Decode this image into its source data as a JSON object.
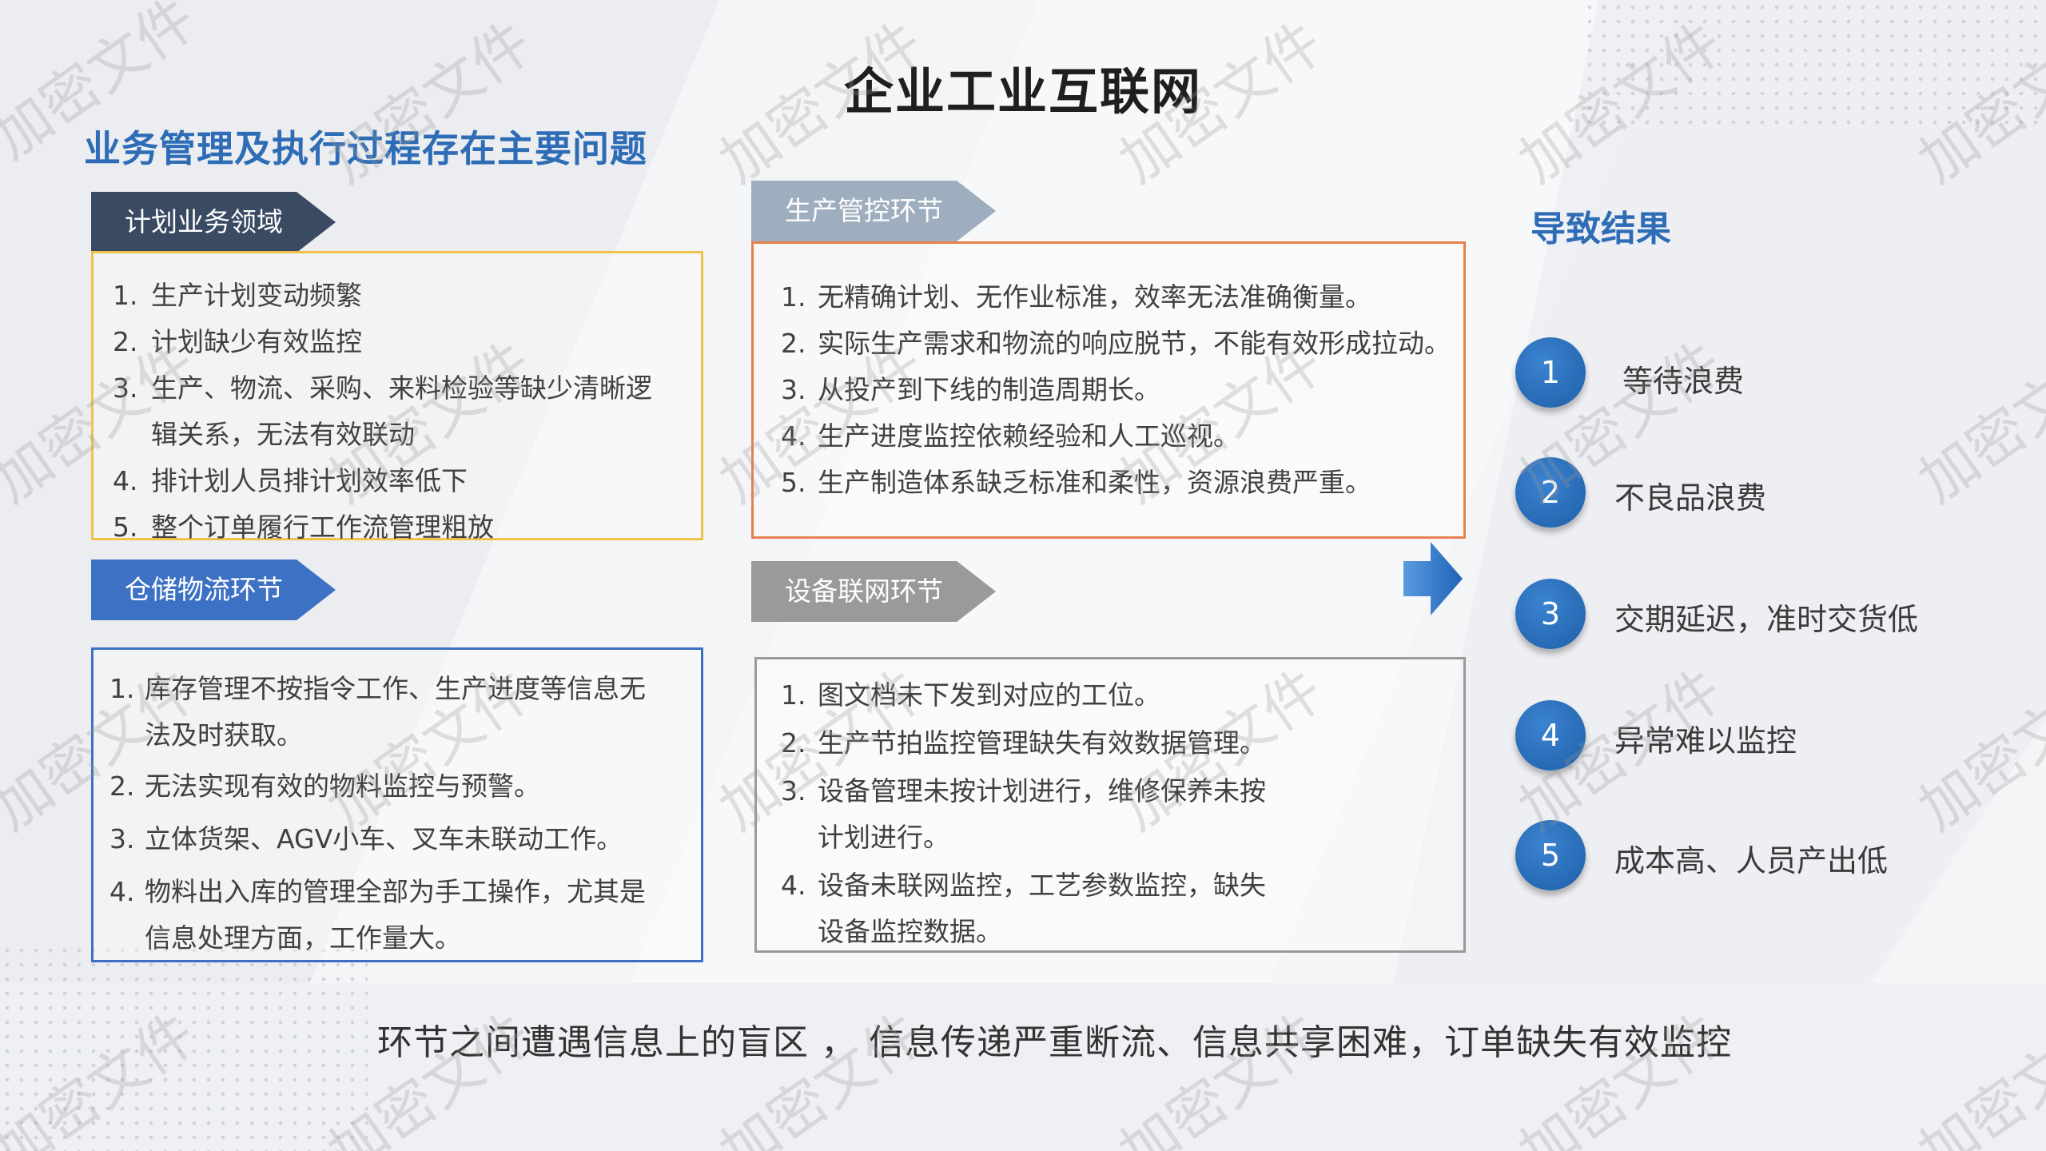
{
  "title": "企业工业互联网",
  "subtitle": "业务管理及执行过程存在主要问题",
  "planning": {
    "tag": "计划业务领域",
    "items": [
      {
        "num": "1.",
        "text": "生产计划变动频繁"
      },
      {
        "num": "2.",
        "text": "计划缺少有效监控"
      },
      {
        "num": "3.",
        "text": "生产、物流、采购、来料检验等缺少清晰逻辑关系，无法有效联动"
      },
      {
        "num": "4.",
        "text": "排计划人员排计划效率低下"
      },
      {
        "num": "5.",
        "text": "整个订单履行工作流管理粗放"
      }
    ]
  },
  "warehouse": {
    "tag": "仓储物流环节",
    "items": [
      {
        "num": "1.",
        "text": "库存管理不按指令工作、生产进度等信息无法及时获取。"
      },
      {
        "num": "2.",
        "text": "无法实现有效的物料监控与预警。"
      },
      {
        "num": "3.",
        "text": "立体货架、AGV小车、叉车未联动工作。"
      },
      {
        "num": "4.",
        "text": "物料出入库的管理全部为手工操作，尤其是信息处理方面，工作量大。"
      }
    ]
  },
  "production": {
    "tag": "生产管控环节",
    "items": [
      {
        "num": "1.",
        "text": "无精确计划、无作业标准，效率无法准确衡量。"
      },
      {
        "num": "2.",
        "text": "实际生产需求和物流的响应脱节，不能有效形成拉动。"
      },
      {
        "num": "3.",
        "text": " 从投产到下线的制造周期长。"
      },
      {
        "num": "4.",
        "text": "生产进度监控依赖经验和人工巡视。"
      },
      {
        "num": "5.",
        "text": "生产制造体系缺乏标准和柔性，资源浪费严重。"
      }
    ]
  },
  "equipment": {
    "tag": "设备联网环节",
    "items": [
      {
        "num": "1.",
        "text": "图文档未下发到对应的工位。"
      },
      {
        "num": "2.",
        "text": "生产节拍监控管理缺失有效数据管理。"
      },
      {
        "num": "3.",
        "text": "设备管理未按计划进行，维修保养未按计划进行。"
      },
      {
        "num": "4.",
        "text": "设备未联网监控，工艺参数监控，缺失设备监控数据。"
      }
    ]
  },
  "results": {
    "heading": "导致结果",
    "items": [
      {
        "num": "1",
        "label": "等待浪费"
      },
      {
        "num": "2",
        "label": "不良品浪费"
      },
      {
        "num": "3",
        "label": "交期延迟，准时交货低"
      },
      {
        "num": "4",
        "label": "异常难以监控"
      },
      {
        "num": "5",
        "label": "成本高、人员产出低"
      }
    ]
  },
  "footer": "环节之间遭遇信息上的盲区 ， 信息传递严重断流、信息共享困难，订单缺失有效监控",
  "watermark": "加密文件",
  "colors": {
    "accent_blue": "#2e6db6",
    "planning_border": "#f0c24a",
    "production_border": "#e8804d",
    "warehouse_border": "#3d6fc2",
    "equipment_border": "#9a9a9a",
    "circle": "#1f5fa8"
  },
  "icons": {
    "arrow": "right-arrow-icon"
  }
}
